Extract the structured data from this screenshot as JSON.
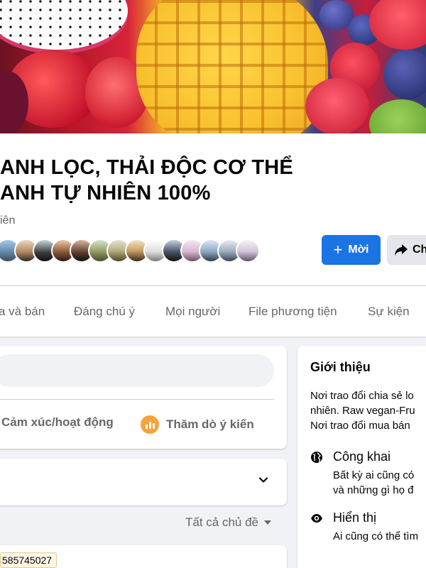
{
  "group": {
    "title_line1": "ANH LỌC, THẢI ĐỘC CƠ THỂ",
    "title_line2": "ANH TỰ NHIÊN 100%",
    "privacy": "iên"
  },
  "actions": {
    "invite_label": "Mời",
    "invite_icon": "plus-icon",
    "share_label": "Ch",
    "share_icon": "share-arrow-icon"
  },
  "tabs": [
    {
      "label": "a và bán"
    },
    {
      "label": "Đáng chú ý"
    },
    {
      "label": "Mọi người"
    },
    {
      "label": "File phương tiện"
    },
    {
      "label": "Sự kiện"
    }
  ],
  "composer": {
    "feeling_label": "Cảm xúc/hoạt động",
    "poll_label": "Thăm dò ý kiến",
    "poll_icon": "poll-icon"
  },
  "feed": {
    "topics_label": "Tất cả chủ đề",
    "phone_tag": "585745027"
  },
  "about": {
    "title": "Giới thiệu",
    "desc_line1": "Nơi trao đổi chia sẻ lo",
    "desc_line2": "nhiên. Raw vegan-Fru",
    "desc_line3": "Nơi trao đổi mua bán",
    "items": [
      {
        "icon": "globe-icon",
        "title": "Công khai",
        "line1": "Bất kỳ ai cũng có",
        "line2": "và những gì họ đ"
      },
      {
        "icon": "eye-icon",
        "title": "Hiển thị",
        "line1": "Ai cũng có thể tìm"
      }
    ]
  },
  "colors": {
    "primary": "#1b74e4",
    "secondary_button": "#e4e6eb",
    "text_secondary": "#65676b",
    "poll_icon": "#f5a33b"
  }
}
